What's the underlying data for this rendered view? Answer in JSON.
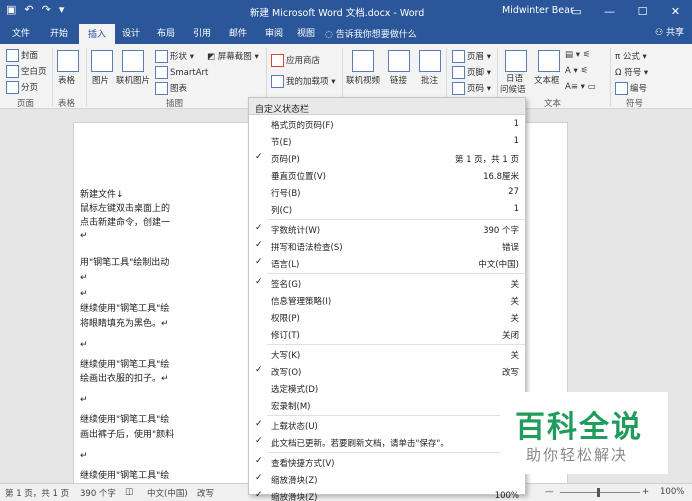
{
  "titlebar": {
    "title": "新建 Microsoft Word 文档.docx - Word",
    "user": "Midwinter Bear"
  },
  "tabs": [
    "文件",
    "开始",
    "插入",
    "设计",
    "布局",
    "引用",
    "邮件",
    "审阅",
    "视图"
  ],
  "tellme": "告诉我你想要做什么",
  "share": "共享",
  "ribbon": {
    "cover": "封面",
    "blank": "空白页",
    "pagebreak": "分页",
    "g_pages": "页面",
    "table": "表格",
    "g_table": "表格",
    "pic": "图片",
    "online_pic": "联机图片",
    "shapes": "形状",
    "smartart": "SmartArt",
    "chart": "图表",
    "screenshot": "屏幕截图",
    "g_illus": "插图",
    "store": "应用商店",
    "addins": "我的加载项",
    "video": "联机视频",
    "link": "链接",
    "comment": "批注",
    "header": "页眉",
    "footer": "页脚",
    "pagenum": "页码",
    "date": "日语",
    "date2": "问候语",
    "textbox": "文本框",
    "g_text": "文本",
    "eq": "公式",
    "sym": "符号",
    "num": "编号",
    "g_sym": "符号"
  },
  "menu": {
    "header": "自定义状态栏",
    "items": [
      {
        "c": "",
        "l": "格式页的页码(F)",
        "v": "1"
      },
      {
        "c": "",
        "l": "节(E)",
        "v": "1"
      },
      {
        "c": "✓",
        "l": "页码(P)",
        "v": "第 1 页，共 1 页"
      },
      {
        "c": "",
        "l": "垂直页位置(V)",
        "v": "16.8厘米"
      },
      {
        "c": "",
        "l": "行号(B)",
        "v": "27"
      },
      {
        "c": "",
        "l": "列(C)",
        "v": "1"
      },
      {
        "c": "✓",
        "l": "字数统计(W)",
        "v": "390 个字"
      },
      {
        "c": "✓",
        "l": "拼写和语法检查(S)",
        "v": "错误"
      },
      {
        "c": "✓",
        "l": "语言(L)",
        "v": "中文(中国)"
      },
      {
        "c": "✓",
        "l": "签名(G)",
        "v": "关"
      },
      {
        "c": "",
        "l": "信息管理策略(I)",
        "v": "关"
      },
      {
        "c": "",
        "l": "权限(P)",
        "v": "关"
      },
      {
        "c": "",
        "l": "修订(T)",
        "v": "关闭"
      },
      {
        "c": "",
        "l": "大写(K)",
        "v": "关"
      },
      {
        "c": "✓",
        "l": "改写(O)",
        "v": "改写"
      },
      {
        "c": "",
        "l": "选定模式(D)",
        "v": ""
      },
      {
        "c": "",
        "l": "宏录制(M)",
        "v": ""
      },
      {
        "c": "✓",
        "l": "上载状态(U)",
        "v": ""
      },
      {
        "c": "✓",
        "l": "此文档已更新。若要刷新文档，请单击\"保存\"。",
        "v": ""
      },
      {
        "c": "✓",
        "l": "查看快捷方式(V)",
        "v": ""
      },
      {
        "c": "✓",
        "l": "缩放滑块(Z)",
        "v": ""
      },
      {
        "c": "✓",
        "l": "缩放滑块(Z)",
        "v": "100%"
      }
    ]
  },
  "doc": [
    "新建文件↓",
    "鼠标左键双击桌面上的",
    "点击新建命令，创建一",
    "↵",
    "用\"钢笔工具\"绘制出动",
    "↵",
    "↵",
    "继续使用\"钢笔工具\"绘",
    "将眼睛填充为黑色。↵",
    "↵",
    "继续使用\"钢笔工具\"绘",
    "绘画出衣服的扣子。↵",
    "↵",
    "继续使用\"钢笔工具\"绘",
    "画出裤子后，使用\"颜料",
    "↵",
    "继续使用\"钢笔工具\"绘"
  ],
  "status": {
    "page": "第 1 页，共 1 页",
    "words": "390 个字",
    "lang": "中文(中国)",
    "mode": "改写",
    "zoom": "100%"
  },
  "watermark": {
    "a": "百科全说",
    "b": "助你轻松解决"
  }
}
